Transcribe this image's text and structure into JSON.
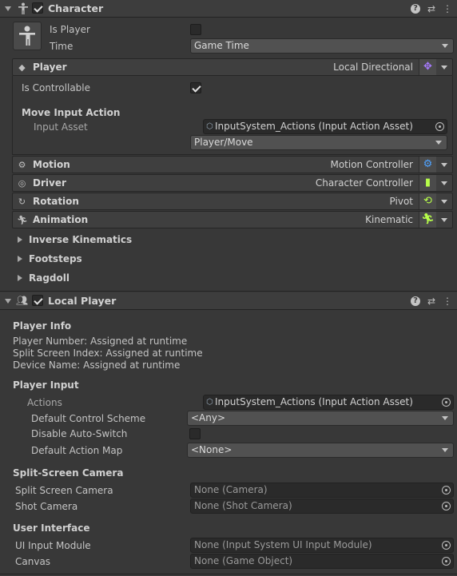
{
  "character": {
    "title": "Character",
    "is_player_label": "Is Player",
    "time_label": "Time",
    "time_value": "Game Time",
    "player_section": {
      "name": "Player",
      "value": "Local Directional"
    },
    "is_controllable_label": "Is Controllable",
    "move_input_action_label": "Move Input Action",
    "input_asset_label": "Input Asset",
    "input_asset_value": "InputSystem_Actions (Input Action Asset)",
    "action_value": "Player/Move",
    "sections": [
      {
        "name": "Motion",
        "value": "Motion Controller"
      },
      {
        "name": "Driver",
        "value": "Character Controller"
      },
      {
        "name": "Rotation",
        "value": "Pivot"
      },
      {
        "name": "Animation",
        "value": "Kinematic"
      }
    ],
    "foldouts": [
      "Inverse Kinematics",
      "Footsteps",
      "Ragdoll"
    ]
  },
  "local_player": {
    "title": "Local Player",
    "player_info_header": "Player Info",
    "player_number": "Player Number: Assigned at runtime",
    "split_screen_index": "Split Screen Index: Assigned at runtime",
    "device_name": "Device Name: Assigned at runtime",
    "player_input_header": "Player Input",
    "actions_label": "Actions",
    "actions_value": "InputSystem_Actions (Input Action Asset)",
    "default_control_scheme_label": "Default Control Scheme",
    "default_control_scheme_value": "<Any>",
    "disable_auto_switch_label": "Disable Auto-Switch",
    "default_action_map_label": "Default Action Map",
    "default_action_map_value": "<None>",
    "split_screen_camera_header": "Split-Screen Camera",
    "split_screen_camera_label": "Split Screen Camera",
    "split_screen_camera_value": "None (Camera)",
    "shot_camera_label": "Shot Camera",
    "shot_camera_value": "None (Shot Camera)",
    "user_interface_header": "User Interface",
    "ui_input_module_label": "UI Input Module",
    "ui_input_module_value": "None (Input System UI Input Module)",
    "canvas_label": "Canvas",
    "canvas_value": "None (Game Object)"
  },
  "colors": {
    "motion_icon": "#4fa3ff",
    "driver_icon": "#b8ff4a",
    "rotation_icon": "#b8ff4a",
    "animation_icon": "#b8ff4a",
    "player_icon": "#a77bff"
  }
}
